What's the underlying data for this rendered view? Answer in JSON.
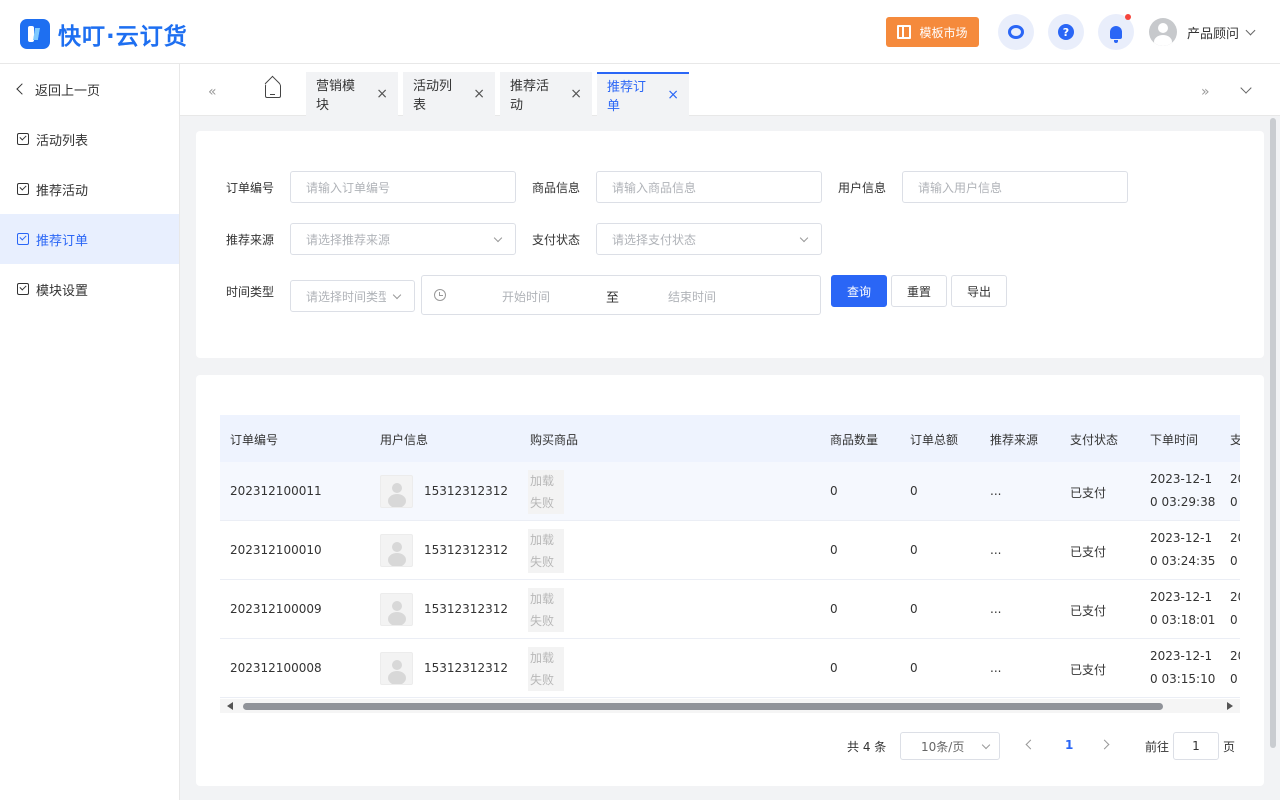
{
  "header": {
    "brand": "快叮·云订货",
    "template_market": "模板市场",
    "user_name": "产品顾问",
    "help_glyph": "?",
    "icons": [
      "customer-service-icon",
      "help-icon",
      "bell-icon"
    ]
  },
  "sidebar": {
    "back_label": "返回上一页",
    "items": [
      {
        "label": "活动列表",
        "active": false
      },
      {
        "label": "推荐活动",
        "active": false
      },
      {
        "label": "推荐订单",
        "active": true
      },
      {
        "label": "模块设置",
        "active": false
      }
    ]
  },
  "tabs": {
    "prev": "«",
    "next": "»",
    "items": [
      {
        "label": "营销模块",
        "active": false
      },
      {
        "label": "活动列表",
        "active": false
      },
      {
        "label": "推荐活动",
        "active": false
      },
      {
        "label": "推荐订单",
        "active": true
      }
    ],
    "close_glyph": "×"
  },
  "filters": {
    "order_no": {
      "label": "订单编号",
      "placeholder": "请输入订单编号"
    },
    "product": {
      "label": "商品信息",
      "placeholder": "请输入商品信息"
    },
    "user": {
      "label": "用户信息",
      "placeholder": "请输入用户信息"
    },
    "source": {
      "label": "推荐来源",
      "placeholder": "请选择推荐来源"
    },
    "pay_status": {
      "label": "支付状态",
      "placeholder": "请选择支付状态"
    },
    "time_type": {
      "label": "时间类型",
      "placeholder": "请选择时间类型"
    },
    "range": {
      "start": "开始时间",
      "sep": "至",
      "end": "结束时间"
    },
    "buttons": {
      "query": "查询",
      "reset": "重置",
      "export": "导出"
    }
  },
  "table": {
    "columns": [
      "订单编号",
      "用户信息",
      "购买商品",
      "商品数量",
      "订单总额",
      "推荐来源",
      "支付状态",
      "下单时间",
      "支"
    ],
    "load_fail": [
      "加载",
      "失败"
    ],
    "rows": [
      {
        "order_no": "202312100011",
        "user": "15312312312",
        "qty": "0",
        "total": "0",
        "source": "...",
        "status": "已支付",
        "time1": "2023-12-1",
        "time2": "0 03:29:38",
        "next1": "20",
        "next2": "0"
      },
      {
        "order_no": "202312100010",
        "user": "15312312312",
        "qty": "0",
        "total": "0",
        "source": "...",
        "status": "已支付",
        "time1": "2023-12-1",
        "time2": "0 03:24:35",
        "next1": "20",
        "next2": "0"
      },
      {
        "order_no": "202312100009",
        "user": "15312312312",
        "qty": "0",
        "total": "0",
        "source": "...",
        "status": "已支付",
        "time1": "2023-12-1",
        "time2": "0 03:18:01",
        "next1": "20",
        "next2": "0"
      },
      {
        "order_no": "202312100008",
        "user": "15312312312",
        "qty": "0",
        "total": "0",
        "source": "...",
        "status": "已支付",
        "time1": "2023-12-1",
        "time2": "0 03:15:10",
        "next1": "20",
        "next2": "0"
      }
    ]
  },
  "pagination": {
    "total": "共 4 条",
    "page_size": "10条/页",
    "current": "1",
    "goto_prefix": "前往",
    "goto_value": "1",
    "goto_suffix": "页"
  },
  "colors": {
    "accent": "#2a66f6",
    "template_btn": "#f58a3c",
    "active_bg": "#e8effe"
  }
}
